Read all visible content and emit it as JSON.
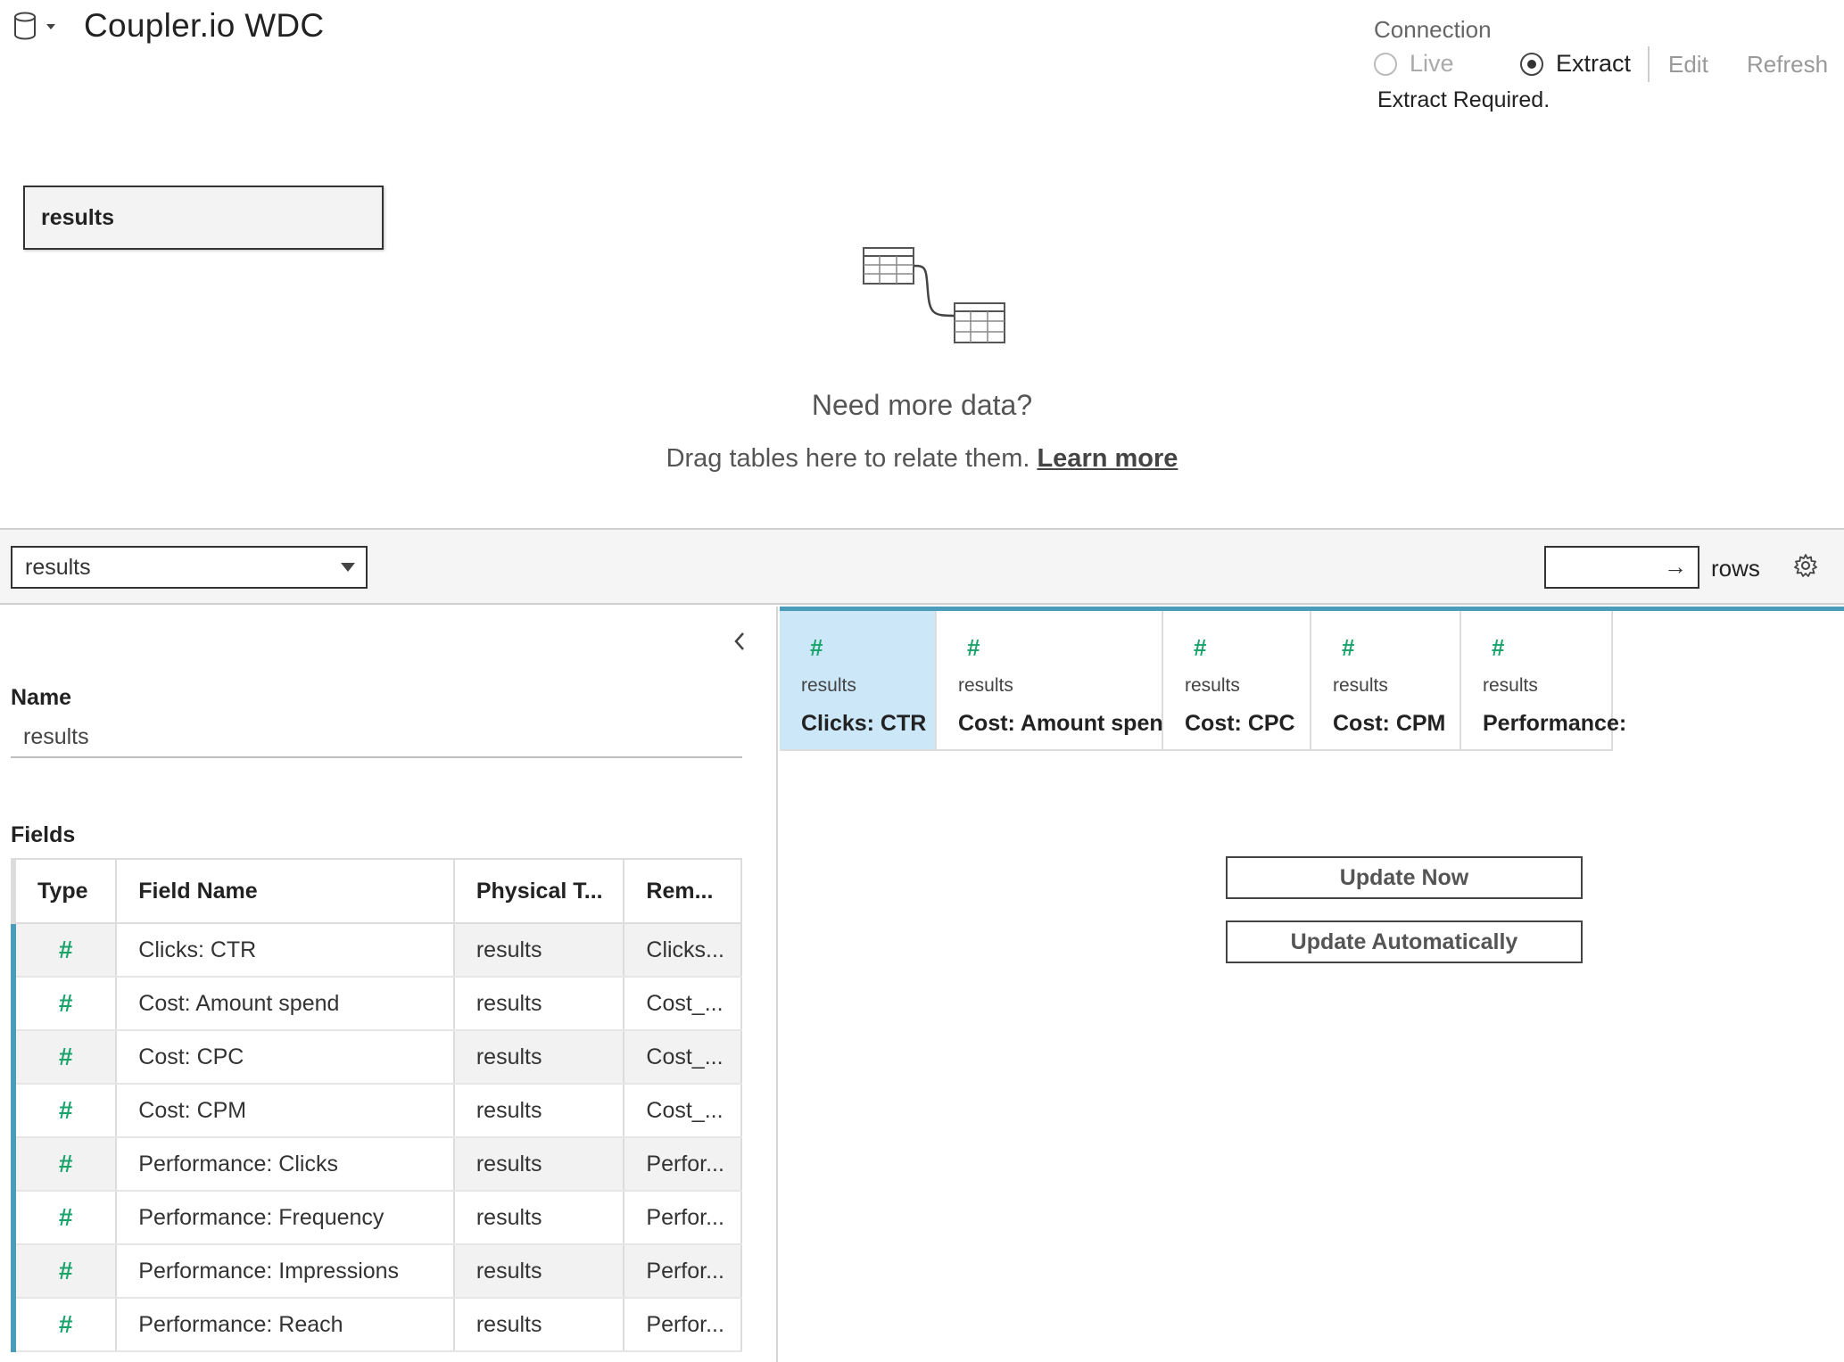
{
  "header": {
    "datasource_title": "Coupler.io WDC",
    "datasource_icon": "database-icon"
  },
  "connection": {
    "label": "Connection",
    "live_label": "Live",
    "extract_label": "Extract",
    "selected": "Extract",
    "edit_label": "Edit",
    "refresh_label": "Refresh",
    "status": "Extract Required."
  },
  "canvas": {
    "table_chip": "results",
    "empty_title": "Need more data?",
    "empty_text": "Drag tables here to relate them.",
    "learn_more": "Learn more"
  },
  "toolbar": {
    "table_select_value": "results",
    "rows_value": "",
    "rows_label": "rows"
  },
  "details": {
    "name_label": "Name",
    "name_value": "results",
    "fields_label": "Fields",
    "columns": [
      "Type",
      "Field Name",
      "Physical T...",
      "Rem..."
    ],
    "rows": [
      {
        "type": "#",
        "field": "Clicks: CTR",
        "physical": "results",
        "remote": "Clicks..."
      },
      {
        "type": "#",
        "field": "Cost: Amount spend",
        "physical": "results",
        "remote": "Cost_..."
      },
      {
        "type": "#",
        "field": "Cost: CPC",
        "physical": "results",
        "remote": "Cost_..."
      },
      {
        "type": "#",
        "field": "Cost: CPM",
        "physical": "results",
        "remote": "Cost_..."
      },
      {
        "type": "#",
        "field": "Performance: Clicks",
        "physical": "results",
        "remote": "Perfor..."
      },
      {
        "type": "#",
        "field": "Performance: Frequency",
        "physical": "results",
        "remote": "Perfor..."
      },
      {
        "type": "#",
        "field": "Performance: Impressions",
        "physical": "results",
        "remote": "Perfor..."
      },
      {
        "type": "#",
        "field": "Performance: Reach",
        "physical": "results",
        "remote": "Perfor..."
      }
    ]
  },
  "grid": {
    "columns": [
      {
        "type": "#",
        "source": "results",
        "name": "Clicks: CTR",
        "selected": true
      },
      {
        "type": "#",
        "source": "results",
        "name": "Cost: Amount spend",
        "selected": false
      },
      {
        "type": "#",
        "source": "results",
        "name": "Cost: CPC",
        "selected": false
      },
      {
        "type": "#",
        "source": "results",
        "name": "Cost: CPM",
        "selected": false
      },
      {
        "type": "#",
        "source": "results",
        "name": "Performance:",
        "selected": false
      }
    ],
    "update_now": "Update Now",
    "update_automatically": "Update Automatically"
  },
  "colors": {
    "accent": "#4b9cbb",
    "numeric_type": "#1aa36b",
    "selected_column": "#cbe7f8"
  }
}
